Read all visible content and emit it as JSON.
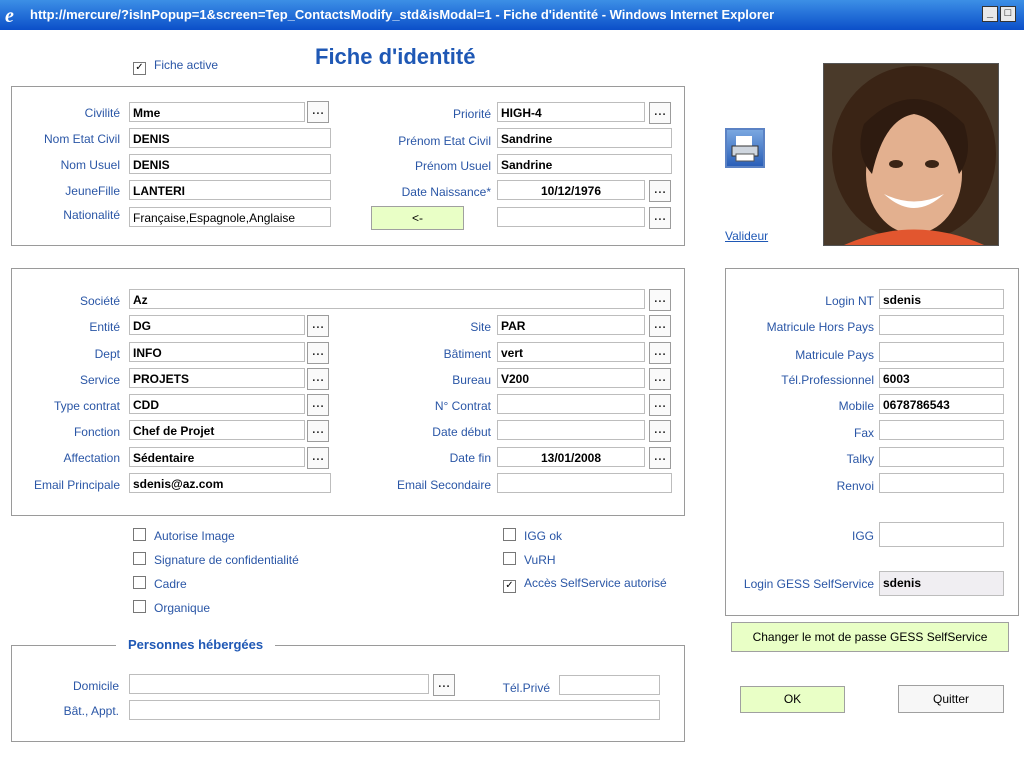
{
  "window": {
    "title": "http://mercure/?isInPopup=1&screen=Tep_ContactsModify_std&isModal=1 - Fiche d'identité - Windows Internet Explorer",
    "minimize": "_",
    "maximize": "□"
  },
  "header": {
    "fiche_active_label": "Fiche active",
    "page_title": "Fiche d'identité"
  },
  "identity": {
    "civilite": {
      "label": "Civilité",
      "value": "Mme"
    },
    "nom_etat_civil": {
      "label": "Nom Etat Civil",
      "value": "DENIS"
    },
    "nom_usuel": {
      "label": "Nom Usuel",
      "value": "DENIS"
    },
    "jeune_fille": {
      "label": "JeuneFille",
      "value": "LANTERI"
    },
    "nationalite": {
      "label": "Nationalité",
      "value": "Française,Espagnole,Anglaise"
    },
    "priorite": {
      "label": "Priorité",
      "value": "HIGH-4"
    },
    "prenom_etat_civil": {
      "label": "Prénom Etat Civil",
      "value": "Sandrine"
    },
    "prenom_usuel": {
      "label": "Prénom Usuel",
      "value": "Sandrine"
    },
    "date_naissance": {
      "label": "Date Naissance*",
      "value": "10/12/1976"
    },
    "arrow_button": "<-",
    "extra_value": ""
  },
  "dots_label": "...",
  "valideur_label": "Valideur",
  "org": {
    "societe": {
      "label": "Société",
      "value": "Az"
    },
    "entite": {
      "label": "Entité",
      "value": "DG"
    },
    "dept": {
      "label": "Dept",
      "value": "INFO"
    },
    "service": {
      "label": "Service",
      "value": "PROJETS"
    },
    "type_contrat": {
      "label": "Type contrat",
      "value": "CDD"
    },
    "fonction": {
      "label": "Fonction",
      "value": "Chef de Projet"
    },
    "affectation": {
      "label": "Affectation",
      "value": "Sédentaire"
    },
    "email_principale": {
      "label": "Email Principale",
      "value": "sdenis@az.com"
    },
    "site": {
      "label": "Site",
      "value": "PAR"
    },
    "batiment": {
      "label": "Bâtiment",
      "value": "vert"
    },
    "bureau": {
      "label": "Bureau",
      "value": "V200"
    },
    "no_contrat": {
      "label": "N° Contrat",
      "value": ""
    },
    "date_debut": {
      "label": "Date début",
      "value": ""
    },
    "date_fin": {
      "label": "Date fin",
      "value": "13/01/2008"
    },
    "email_secondaire": {
      "label": "Email Secondaire",
      "value": ""
    }
  },
  "contact": {
    "login_nt": {
      "label": "Login NT",
      "value": "sdenis"
    },
    "matricule_hors_pays": {
      "label": "Matricule Hors Pays",
      "value": ""
    },
    "matricule_pays": {
      "label": "Matricule Pays",
      "value": ""
    },
    "tel_pro": {
      "label": "Tél.Professionnel",
      "value": "6003"
    },
    "mobile": {
      "label": "Mobile",
      "value": "0678786543"
    },
    "fax": {
      "label": "Fax",
      "value": ""
    },
    "talky": {
      "label": "Talky",
      "value": ""
    },
    "renvoi": {
      "label": "Renvoi",
      "value": ""
    },
    "igg": {
      "label": "IGG",
      "value": ""
    },
    "login_gess": {
      "label": "Login GESS SelfService",
      "value": "sdenis"
    }
  },
  "checkboxes": {
    "autorise_image": {
      "label": "Autorise Image",
      "checked": false
    },
    "signature": {
      "label": "Signature de confidentialité",
      "checked": false
    },
    "cadre": {
      "label": "Cadre",
      "checked": false
    },
    "organique": {
      "label": "Organique",
      "checked": false
    },
    "igg_ok": {
      "label": "IGG ok",
      "checked": false
    },
    "vurh": {
      "label": "VuRH",
      "checked": false
    },
    "acces_selfservice": {
      "label": "Accès SelfService autorisé",
      "checked": true
    }
  },
  "hosted": {
    "legend": "Personnes hébergées",
    "domicile": {
      "label": "Domicile",
      "value": ""
    },
    "bat_appt": {
      "label": "Bât., Appt.",
      "value": ""
    },
    "tel_prive": {
      "label": "Tél.Privé",
      "value": ""
    }
  },
  "buttons": {
    "change_password": "Changer le mot de passe GESS SelfService",
    "ok": "OK",
    "quitter": "Quitter"
  },
  "colors": {
    "label_blue": "#2a56a6",
    "title_blue": "#1f58b5",
    "button_green": "#e9ffc6",
    "titlebar_blue": "#0b4fc9"
  }
}
